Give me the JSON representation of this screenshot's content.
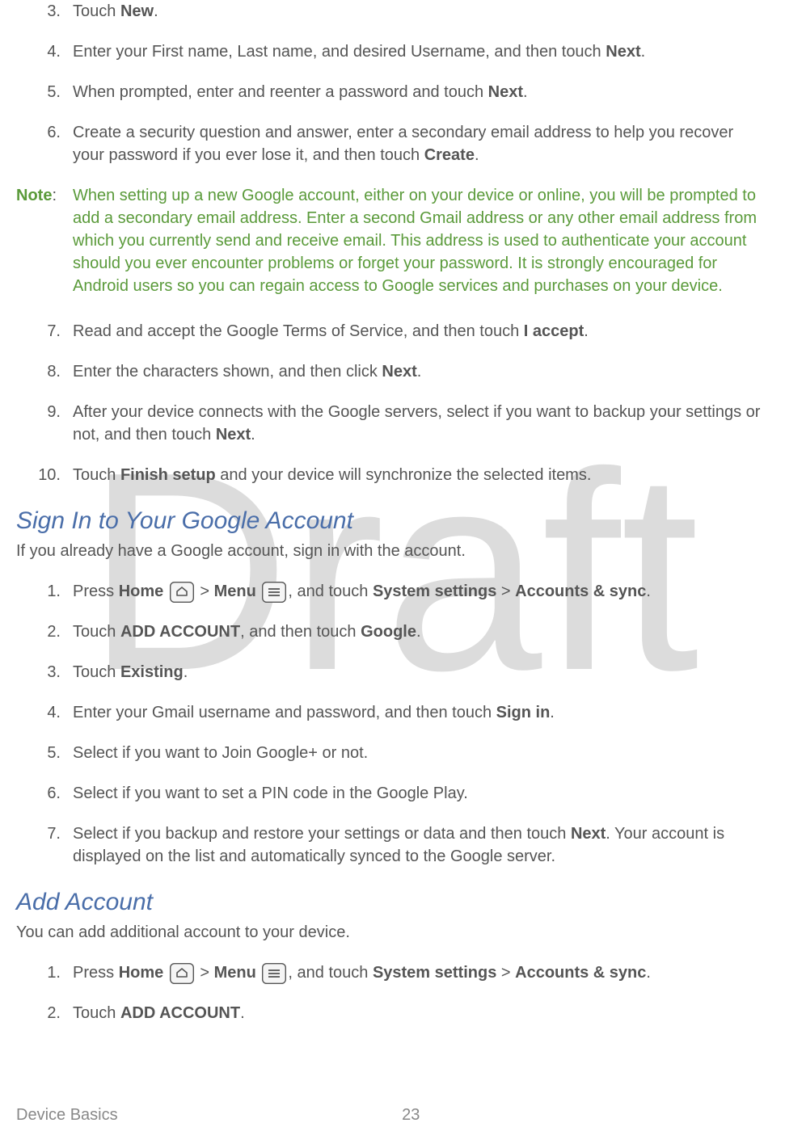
{
  "watermark": "Draft",
  "list_a": [
    {
      "num": "3.",
      "parts": [
        "Touch ",
        {
          "b": "New"
        },
        "."
      ]
    },
    {
      "num": "4.",
      "parts": [
        "Enter your First name, Last name, and desired Username, and then touch ",
        {
          "b": "Next"
        },
        "."
      ]
    },
    {
      "num": "5.",
      "parts": [
        "When prompted, enter and reenter a password and touch ",
        {
          "b": "Next"
        },
        "."
      ]
    },
    {
      "num": "6.",
      "parts": [
        "Create a security question and answer, enter a secondary email address to help you recover your password if you ever lose it, and then touch ",
        {
          "b": "Create"
        },
        "."
      ]
    }
  ],
  "note": {
    "label": "Note",
    "text": "When setting up a new Google account, either on your device or online, you will be prompted to add a secondary email address. Enter a second Gmail address or any other email address from which you currently send and receive email. This address is used to authenticate your account should you ever encounter problems or forget your password. It is strongly encouraged for Android users so you can regain access to Google services and purchases on your device."
  },
  "list_b": [
    {
      "num": "7.",
      "parts": [
        "Read and accept the Google Terms of Service, and then touch ",
        {
          "b": "I accept"
        },
        "."
      ]
    },
    {
      "num": "8.",
      "parts": [
        "Enter the characters shown, and then click ",
        {
          "b": "Next"
        },
        "."
      ]
    },
    {
      "num": "9.",
      "parts": [
        "After your device connects with the Google servers, select if you want to backup your settings or not, and then touch ",
        {
          "b": "Next"
        },
        "."
      ]
    },
    {
      "num": "10.",
      "parts": [
        "Touch ",
        {
          "b": "Finish setup"
        },
        " and your device will synchronize the selected items."
      ]
    }
  ],
  "section_signin": {
    "title": "Sign In to Your Google Account",
    "lead": "If you already have a Google account, sign in with the account.",
    "steps": [
      {
        "num": "1.",
        "parts": [
          "Press ",
          {
            "b": "Home"
          },
          " ",
          {
            "icon": "home"
          },
          " > ",
          {
            "b": "Menu"
          },
          " ",
          {
            "icon": "menu"
          },
          ", and touch ",
          {
            "b": "System settings"
          },
          " > ",
          {
            "b": "Accounts & sync"
          },
          "."
        ]
      },
      {
        "num": "2.",
        "parts": [
          "Touch ",
          {
            "b": "ADD ACCOUNT"
          },
          ", and then touch ",
          {
            "b": "Google"
          },
          "."
        ]
      },
      {
        "num": "3.",
        "parts": [
          "Touch ",
          {
            "b": "Existing"
          },
          "."
        ]
      },
      {
        "num": "4.",
        "parts": [
          "Enter your Gmail username and password, and then touch ",
          {
            "b": "Sign in"
          },
          "."
        ]
      },
      {
        "num": "5.",
        "parts": [
          "Select if you want to Join Google+ or not."
        ]
      },
      {
        "num": "6.",
        "parts": [
          "Select if you want to set a PIN code in the Google Play."
        ]
      },
      {
        "num": "7.",
        "parts": [
          "Select if you backup and restore your settings or data and then touch ",
          {
            "b": "Next"
          },
          ". Your account is displayed on the list and automatically synced to the Google server."
        ]
      }
    ]
  },
  "section_add": {
    "title": "Add Account",
    "lead": "You can add additional account to your device.",
    "steps": [
      {
        "num": "1.",
        "parts": [
          "Press ",
          {
            "b": "Home"
          },
          " ",
          {
            "icon": "home"
          },
          " > ",
          {
            "b": "Menu"
          },
          " ",
          {
            "icon": "menu"
          },
          ", and touch ",
          {
            "b": "System settings"
          },
          " > ",
          {
            "b": "Accounts & sync"
          },
          "."
        ]
      },
      {
        "num": "2.",
        "parts": [
          "Touch ",
          {
            "b": "ADD ACCOUNT"
          },
          "."
        ]
      }
    ]
  },
  "footer": {
    "title": "Device Basics",
    "page": "23"
  }
}
